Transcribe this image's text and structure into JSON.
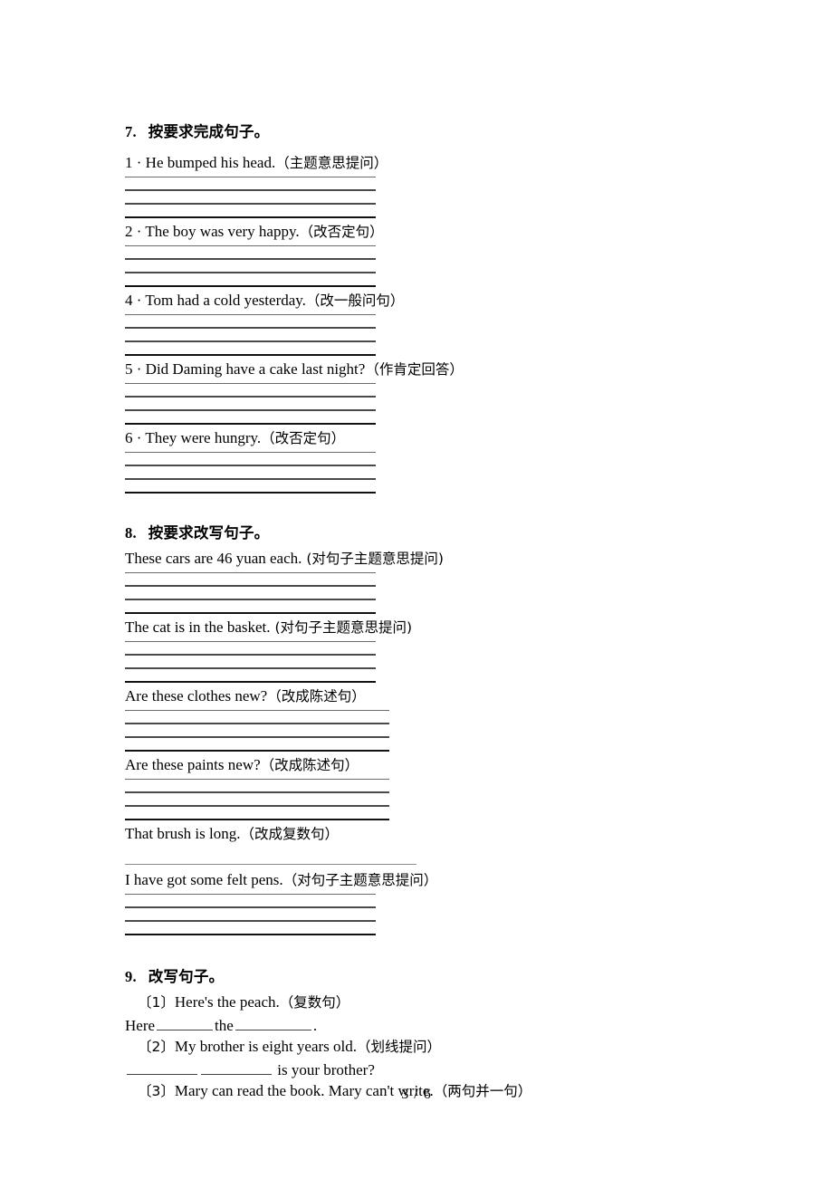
{
  "document": {
    "page_label": "3 / 6"
  },
  "sections": [
    {
      "id": "section-7",
      "heading": "7.   按要求完成句子。",
      "items": [
        {
          "number": "1 · ",
          "sentence": "He bumped his head.",
          "hint": "（主题意思提问）",
          "rules": 4
        },
        {
          "number": "2 · ",
          "sentence": "The boy was very happy.",
          "hint": "（改否定句）",
          "rules": 4
        },
        {
          "number": "4 · ",
          "sentence": "Tom had a cold yesterday.",
          "hint": "（改一般问句）",
          "rules": 4
        },
        {
          "number": "5 · ",
          "sentence": "Did Daming have a cake last night?",
          "hint": "（作肯定回答）",
          "rules": 4
        },
        {
          "number": "6 · ",
          "sentence": "They were hungry.",
          "hint": "（改否定句）",
          "rules": 4
        }
      ]
    },
    {
      "id": "section-8",
      "heading": "8.   按要求改写句子。",
      "items": [
        {
          "number": "",
          "sentence": "These cars are 46 yuan each.",
          "hint": " (对句子主题意思提问)",
          "rules": 4
        },
        {
          "number": "",
          "sentence": "The cat is in the basket.",
          "hint": " (对句子主题意思提问)",
          "rules": 4
        },
        {
          "number": "",
          "sentence": "Are these clothes new?",
          "hint": "（改成陈述句）",
          "rules": 4
        },
        {
          "number": "",
          "sentence": "Are these paints new?",
          "hint": "（改成陈述句）",
          "rules": 4
        },
        {
          "number": "",
          "sentence": "That brush is long.",
          "hint": "（改成复数句）",
          "rules": 1
        },
        {
          "number": "",
          "sentence": "I have got some felt pens.",
          "hint": "（对句子主题意思提问）",
          "rules": 4
        }
      ]
    },
    {
      "id": "section-9",
      "heading": "9.   改写句子。",
      "items": [
        {
          "number": "〔1〕",
          "sentence": "Here's the peach.",
          "hint": "（复数句）",
          "answer_prefix": "Here",
          "answer_middle": "the",
          "answer_suffix": "."
        },
        {
          "number": "〔2〕",
          "sentence": "My brother is eight years old.",
          "hint": "（划线提问）",
          "answer_suffix2": "is your brother?"
        },
        {
          "number": "〔3〕",
          "sentence": "Mary can read the book. Mary can't write.",
          "hint": "（两句并一句）"
        }
      ]
    }
  ]
}
